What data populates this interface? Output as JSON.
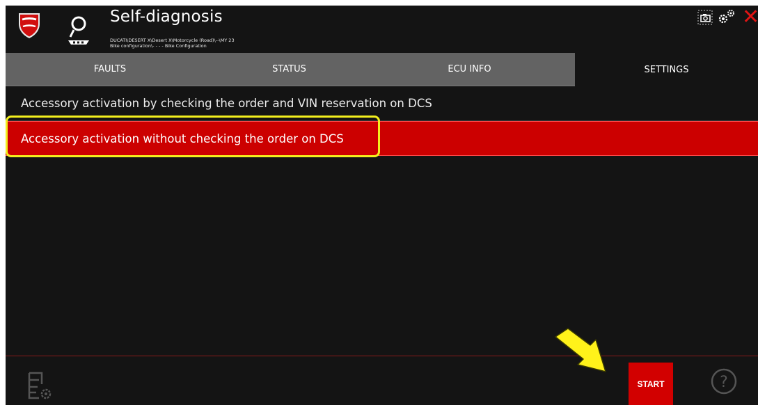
{
  "header": {
    "title": "Self-diagnosis",
    "path_line1": "DUCATI\\DESERT X\\Desert X\\Motorcycle (Road)\\--\\MY 23",
    "path_line2": "Bike configuration\\- - - - Bike Configuration",
    "logo_text": "DUCATI"
  },
  "tabs": [
    {
      "label": "FAULTS"
    },
    {
      "label": "STATUS"
    },
    {
      "label": "ECU INFO"
    },
    {
      "label": "SETTINGS",
      "active": true
    }
  ],
  "settings_list": [
    {
      "label": "Accessory activation by checking the order and VIN reservation on DCS"
    },
    {
      "label": "Accessory activation without checking the order on DCS",
      "selected": true
    }
  ],
  "footer": {
    "start_label": "START",
    "help_symbol": "?"
  },
  "icons": {
    "close": "✕"
  },
  "colors": {
    "accent_red": "#cc0000",
    "background": "#141414",
    "tab_inactive": "#636363",
    "annotation_yellow": "#f3ef1e"
  }
}
